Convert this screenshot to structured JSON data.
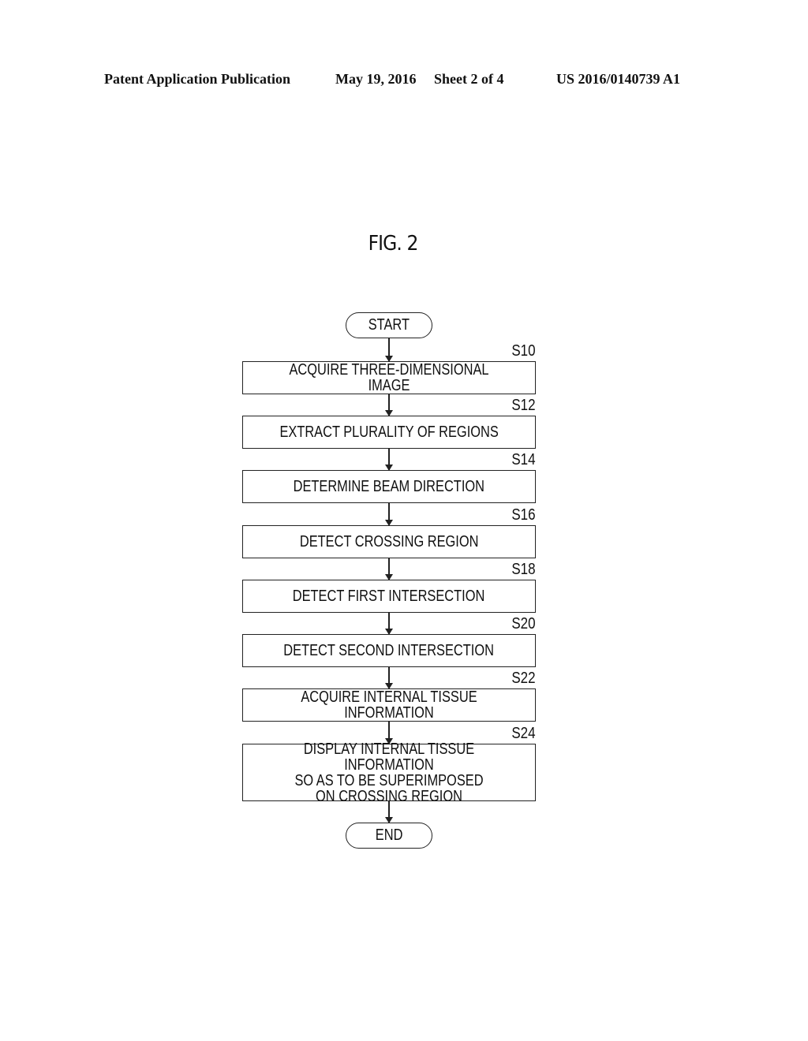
{
  "header": {
    "publication": "Patent Application Publication",
    "date": "May 19, 2016",
    "sheet": "Sheet 2 of 4",
    "number": "US 2016/0140739 A1"
  },
  "figure": {
    "title": "FIG. 2",
    "start": "START",
    "end": "END",
    "steps": [
      {
        "id": "S10",
        "text": "ACQUIRE THREE-DIMENSIONAL IMAGE"
      },
      {
        "id": "S12",
        "text": "EXTRACT PLURALITY OF REGIONS"
      },
      {
        "id": "S14",
        "text": "DETERMINE BEAM DIRECTION"
      },
      {
        "id": "S16",
        "text": "DETECT CROSSING REGION"
      },
      {
        "id": "S18",
        "text": "DETECT FIRST INTERSECTION"
      },
      {
        "id": "S20",
        "text": "DETECT SECOND INTERSECTION"
      },
      {
        "id": "S22",
        "text": "ACQUIRE INTERNAL TISSUE INFORMATION"
      },
      {
        "id": "S24",
        "text": "DISPLAY INTERNAL TISSUE INFORMATION\nSO AS TO BE SUPERIMPOSED\nON CROSSING REGION"
      }
    ]
  }
}
